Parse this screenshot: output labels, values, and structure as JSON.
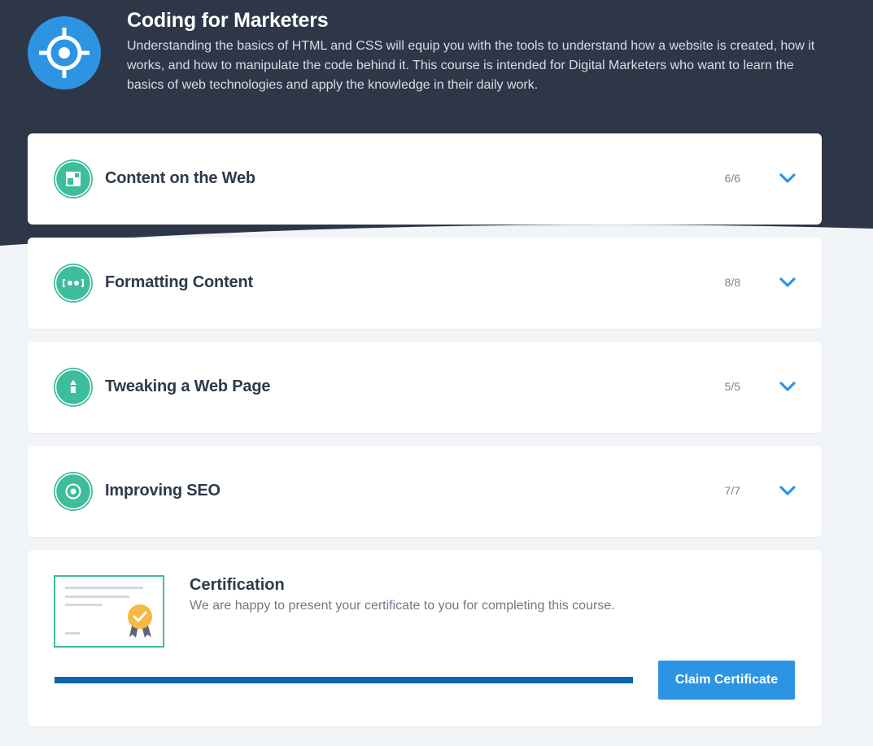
{
  "course": {
    "title": "Coding for Marketers",
    "description": "Understanding the basics of HTML and CSS will equip you with the tools to understand how a website is created, how it works, and how to manipulate the code behind it. This course is intended for Digital Marketers who want to learn the basics of web technologies and apply the knowledge in their daily work.",
    "icon": "crosshair-icon"
  },
  "modules": [
    {
      "title": "Content on the Web",
      "progress": "6/6",
      "icon": "layout-icon"
    },
    {
      "title": "Formatting Content",
      "progress": "8/8",
      "icon": "code-brackets-icon"
    },
    {
      "title": "Tweaking a Web Page",
      "progress": "5/5",
      "icon": "arrow-up-icon"
    },
    {
      "title": "Improving SEO",
      "progress": "7/7",
      "icon": "target-icon"
    }
  ],
  "certification": {
    "title": "Certification",
    "description": "We are happy to present your certificate to you for completing this course.",
    "progress_percent": 100,
    "button_label": "Claim Certificate"
  },
  "colors": {
    "header_bg": "#2d3748",
    "accent_blue": "#2d94e4",
    "module_icon_green": "#3ebd9c",
    "progress_fill": "#0a64b0"
  }
}
